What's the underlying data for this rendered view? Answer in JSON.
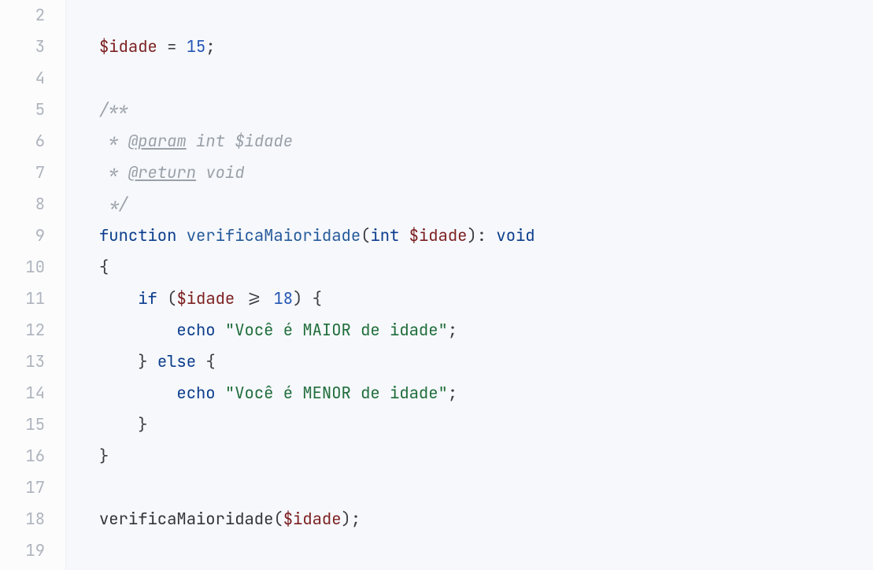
{
  "lines": {
    "2": "2",
    "3": "3",
    "4": "4",
    "5": "5",
    "6": "6",
    "7": "7",
    "8": "8",
    "9": "9",
    "10": "10",
    "11": "11",
    "12": "12",
    "13": "13",
    "14": "14",
    "15": "15",
    "16": "16",
    "17": "17",
    "18": "18",
    "19": "19"
  },
  "tok": {
    "idade_var": "$idade",
    "eq": " = ",
    "semi": ";",
    "n15": "15",
    "c_open": "/**",
    "c_star": " * ",
    "c_close": " */",
    "doc_param": "@param",
    "doc_return": "@return",
    "doc_int": " int ",
    "doc_idade": "$idade",
    "doc_void": " void",
    "kw_function": "function",
    "sp": " ",
    "fn_name": "verificaMaioridade",
    "lparen": "(",
    "rparen": ")",
    "type_int": "int",
    "colon_void": ": ",
    "type_void": "void",
    "lbrace": "{",
    "rbrace": "}",
    "kw_if": "if",
    "ge": " >= ",
    "n18": "18",
    "rparen_sp_lbrace": ") {",
    "kw_echo": "echo",
    "str_maior": "\"Você é MAIOR de idade\"",
    "rbrace_else_lbrace_pre": "} ",
    "kw_else": "else",
    "sp_lbrace": " {",
    "str_menor": "\"Você é MENOR de idade\"",
    "indent1": "    ",
    "indent2": "        ",
    "call_name": "verificaMaioridade"
  }
}
